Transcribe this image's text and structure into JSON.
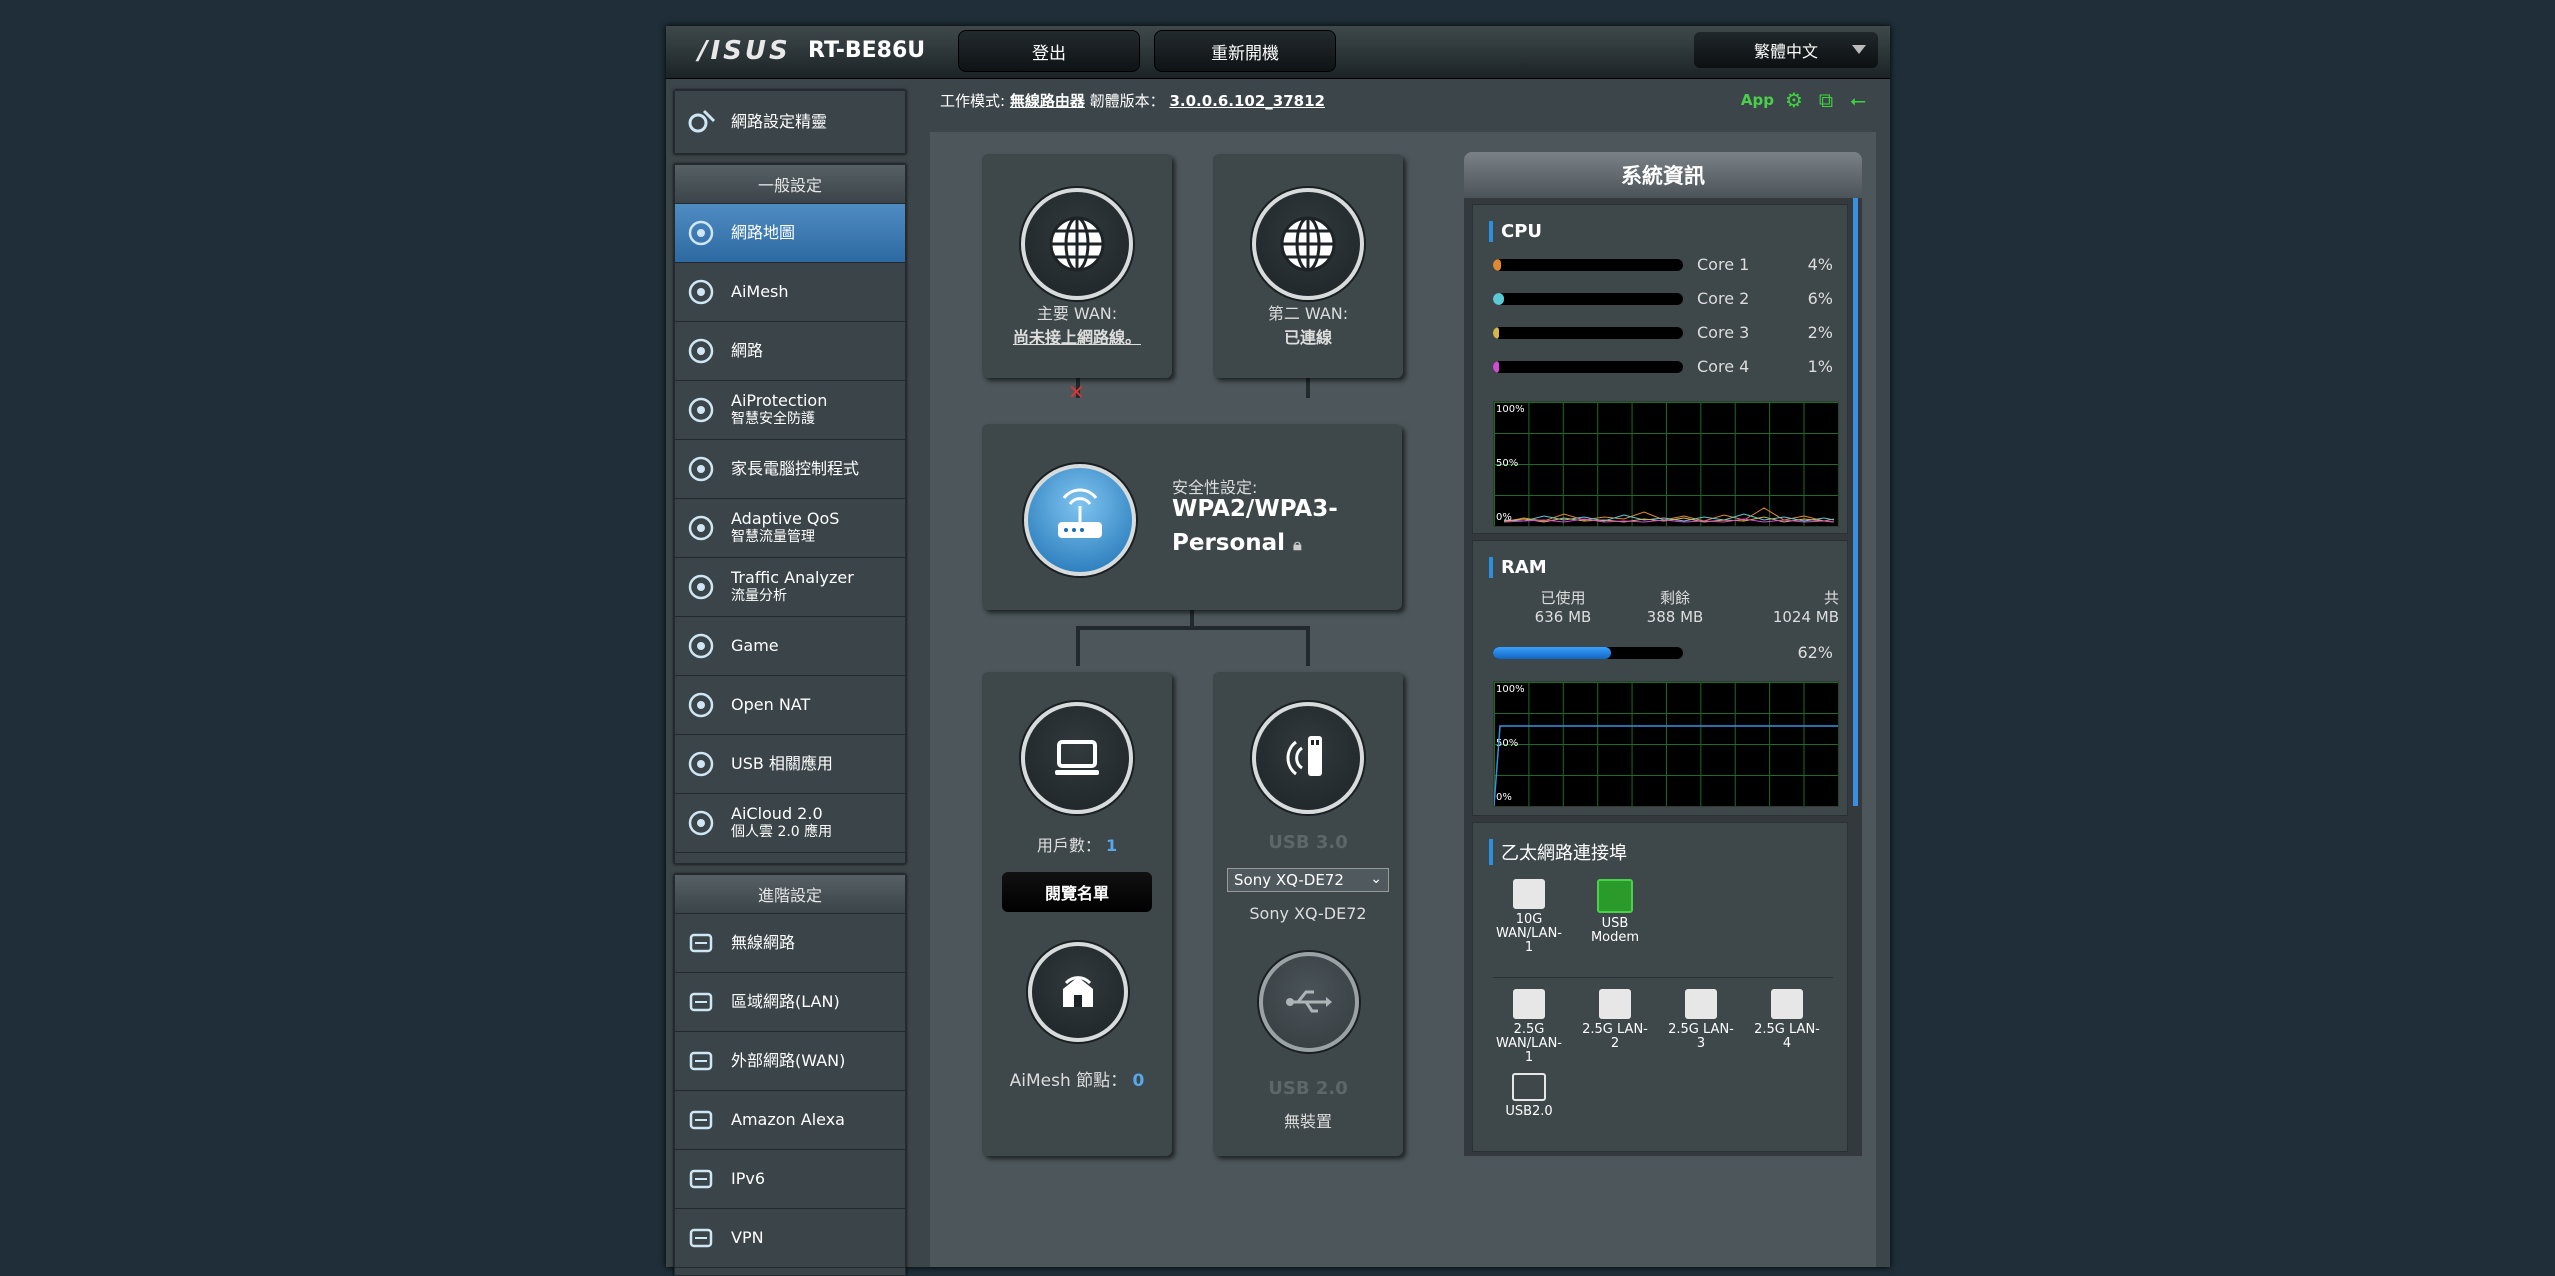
{
  "header": {
    "brand": "/ISUS",
    "model": "RT-BE86U",
    "logout": "登出",
    "reboot": "重新開機",
    "language": "繁體中文"
  },
  "infobar": {
    "mode_label": "工作模式:",
    "mode_value": "無線路由器",
    "fw_label": "韌體版本：",
    "fw_value": "3.0.0.6.102_37812",
    "app": "App"
  },
  "sidebar": {
    "wizard": "網路設定精靈",
    "general_header": "一般設定",
    "general_items": [
      {
        "l1": "網路地圖",
        "l2": ""
      },
      {
        "l1": "AiMesh",
        "l2": ""
      },
      {
        "l1": "網路",
        "l2": ""
      },
      {
        "l1": "AiProtection",
        "l2": "智慧安全防護"
      },
      {
        "l1": "家長電腦控制程式",
        "l2": ""
      },
      {
        "l1": "Adaptive QoS",
        "l2": "智慧流量管理"
      },
      {
        "l1": "Traffic Analyzer",
        "l2": "流量分析"
      },
      {
        "l1": "Game",
        "l2": ""
      },
      {
        "l1": "Open NAT",
        "l2": ""
      },
      {
        "l1": "USB 相關應用",
        "l2": ""
      },
      {
        "l1": "AiCloud 2.0",
        "l2": "個人雲 2.0 應用"
      }
    ],
    "advanced_header": "進階設定",
    "advanced_items": [
      {
        "l1": "無線網路"
      },
      {
        "l1": "區域網路(LAN)"
      },
      {
        "l1": "外部網路(WAN)"
      },
      {
        "l1": "Amazon Alexa"
      },
      {
        "l1": "IPv6"
      },
      {
        "l1": "VPN"
      }
    ]
  },
  "map": {
    "wan1_label": "主要 WAN:",
    "wan1_status": "尚未接上網路線。",
    "wan2_label": "第二 WAN:",
    "wan2_status": "已連線",
    "security_label": "安全性設定:",
    "security_value1": "WPA2/WPA3-",
    "security_value2": "Personal",
    "clients_label": "用戶數：",
    "clients_value": "1",
    "view_list": "閱覽名單",
    "aimesh_label": "AiMesh 節點：",
    "aimesh_value": "0",
    "usb3_label": "USB 3.0",
    "usb3_device": "Sony XQ-DE72",
    "usb3_name": "Sony XQ-DE72",
    "usb2_label": "USB 2.0",
    "usb2_status": "無裝置"
  },
  "system": {
    "title": "系統資訊",
    "cpu_title": "CPU",
    "cores": [
      {
        "name": "Core 1",
        "pct": "4%",
        "value": 0.04,
        "color": "#e08a30"
      },
      {
        "name": "Core 2",
        "pct": "6%",
        "value": 0.06,
        "color": "#5cc9d6"
      },
      {
        "name": "Core 3",
        "pct": "2%",
        "value": 0.02,
        "color": "#d6b84a"
      },
      {
        "name": "Core 4",
        "pct": "1%",
        "value": 0.01,
        "color": "#d64ad6"
      }
    ],
    "graph_100": "100%",
    "graph_50": "50%",
    "graph_0": "0%",
    "ram_title": "RAM",
    "ram_used_label": "已使用",
    "ram_free_label": "剩餘",
    "ram_total_label": "共",
    "ram_used": "636 MB",
    "ram_free": "388 MB",
    "ram_total": "1024 MB",
    "ram_pct": "62%",
    "ram_value": 0.62,
    "eth_title": "乙太網路連接埠",
    "ports_top": [
      {
        "l1": "10G",
        "l2": "WAN/LAN-",
        "l3": "1"
      },
      {
        "l1": "USB",
        "l2": "Modem",
        "l3": ""
      }
    ],
    "ports_bottom": [
      {
        "l1": "2.5G",
        "l2": "WAN/LAN-",
        "l3": "1"
      },
      {
        "l1": "2.5G LAN-",
        "l2": "2",
        "l3": ""
      },
      {
        "l1": "2.5G LAN-",
        "l2": "3",
        "l3": ""
      },
      {
        "l1": "2.5G LAN-",
        "l2": "4",
        "l3": ""
      }
    ],
    "port_usb2": "USB2.0"
  }
}
